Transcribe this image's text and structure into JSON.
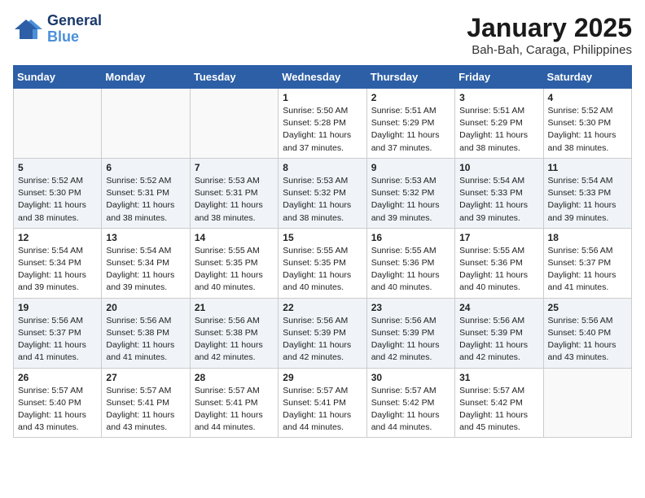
{
  "header": {
    "logo_line1": "General",
    "logo_line2": "Blue",
    "title": "January 2025",
    "subtitle": "Bah-Bah, Caraga, Philippines"
  },
  "days_of_week": [
    "Sunday",
    "Monday",
    "Tuesday",
    "Wednesday",
    "Thursday",
    "Friday",
    "Saturday"
  ],
  "weeks": [
    [
      {
        "day": "",
        "sunrise": "",
        "sunset": "",
        "daylight": ""
      },
      {
        "day": "",
        "sunrise": "",
        "sunset": "",
        "daylight": ""
      },
      {
        "day": "",
        "sunrise": "",
        "sunset": "",
        "daylight": ""
      },
      {
        "day": "1",
        "sunrise": "Sunrise: 5:50 AM",
        "sunset": "Sunset: 5:28 PM",
        "daylight": "Daylight: 11 hours and 37 minutes."
      },
      {
        "day": "2",
        "sunrise": "Sunrise: 5:51 AM",
        "sunset": "Sunset: 5:29 PM",
        "daylight": "Daylight: 11 hours and 37 minutes."
      },
      {
        "day": "3",
        "sunrise": "Sunrise: 5:51 AM",
        "sunset": "Sunset: 5:29 PM",
        "daylight": "Daylight: 11 hours and 38 minutes."
      },
      {
        "day": "4",
        "sunrise": "Sunrise: 5:52 AM",
        "sunset": "Sunset: 5:30 PM",
        "daylight": "Daylight: 11 hours and 38 minutes."
      }
    ],
    [
      {
        "day": "5",
        "sunrise": "Sunrise: 5:52 AM",
        "sunset": "Sunset: 5:30 PM",
        "daylight": "Daylight: 11 hours and 38 minutes."
      },
      {
        "day": "6",
        "sunrise": "Sunrise: 5:52 AM",
        "sunset": "Sunset: 5:31 PM",
        "daylight": "Daylight: 11 hours and 38 minutes."
      },
      {
        "day": "7",
        "sunrise": "Sunrise: 5:53 AM",
        "sunset": "Sunset: 5:31 PM",
        "daylight": "Daylight: 11 hours and 38 minutes."
      },
      {
        "day": "8",
        "sunrise": "Sunrise: 5:53 AM",
        "sunset": "Sunset: 5:32 PM",
        "daylight": "Daylight: 11 hours and 38 minutes."
      },
      {
        "day": "9",
        "sunrise": "Sunrise: 5:53 AM",
        "sunset": "Sunset: 5:32 PM",
        "daylight": "Daylight: 11 hours and 39 minutes."
      },
      {
        "day": "10",
        "sunrise": "Sunrise: 5:54 AM",
        "sunset": "Sunset: 5:33 PM",
        "daylight": "Daylight: 11 hours and 39 minutes."
      },
      {
        "day": "11",
        "sunrise": "Sunrise: 5:54 AM",
        "sunset": "Sunset: 5:33 PM",
        "daylight": "Daylight: 11 hours and 39 minutes."
      }
    ],
    [
      {
        "day": "12",
        "sunrise": "Sunrise: 5:54 AM",
        "sunset": "Sunset: 5:34 PM",
        "daylight": "Daylight: 11 hours and 39 minutes."
      },
      {
        "day": "13",
        "sunrise": "Sunrise: 5:54 AM",
        "sunset": "Sunset: 5:34 PM",
        "daylight": "Daylight: 11 hours and 39 minutes."
      },
      {
        "day": "14",
        "sunrise": "Sunrise: 5:55 AM",
        "sunset": "Sunset: 5:35 PM",
        "daylight": "Daylight: 11 hours and 40 minutes."
      },
      {
        "day": "15",
        "sunrise": "Sunrise: 5:55 AM",
        "sunset": "Sunset: 5:35 PM",
        "daylight": "Daylight: 11 hours and 40 minutes."
      },
      {
        "day": "16",
        "sunrise": "Sunrise: 5:55 AM",
        "sunset": "Sunset: 5:36 PM",
        "daylight": "Daylight: 11 hours and 40 minutes."
      },
      {
        "day": "17",
        "sunrise": "Sunrise: 5:55 AM",
        "sunset": "Sunset: 5:36 PM",
        "daylight": "Daylight: 11 hours and 40 minutes."
      },
      {
        "day": "18",
        "sunrise": "Sunrise: 5:56 AM",
        "sunset": "Sunset: 5:37 PM",
        "daylight": "Daylight: 11 hours and 41 minutes."
      }
    ],
    [
      {
        "day": "19",
        "sunrise": "Sunrise: 5:56 AM",
        "sunset": "Sunset: 5:37 PM",
        "daylight": "Daylight: 11 hours and 41 minutes."
      },
      {
        "day": "20",
        "sunrise": "Sunrise: 5:56 AM",
        "sunset": "Sunset: 5:38 PM",
        "daylight": "Daylight: 11 hours and 41 minutes."
      },
      {
        "day": "21",
        "sunrise": "Sunrise: 5:56 AM",
        "sunset": "Sunset: 5:38 PM",
        "daylight": "Daylight: 11 hours and 42 minutes."
      },
      {
        "day": "22",
        "sunrise": "Sunrise: 5:56 AM",
        "sunset": "Sunset: 5:39 PM",
        "daylight": "Daylight: 11 hours and 42 minutes."
      },
      {
        "day": "23",
        "sunrise": "Sunrise: 5:56 AM",
        "sunset": "Sunset: 5:39 PM",
        "daylight": "Daylight: 11 hours and 42 minutes."
      },
      {
        "day": "24",
        "sunrise": "Sunrise: 5:56 AM",
        "sunset": "Sunset: 5:39 PM",
        "daylight": "Daylight: 11 hours and 42 minutes."
      },
      {
        "day": "25",
        "sunrise": "Sunrise: 5:56 AM",
        "sunset": "Sunset: 5:40 PM",
        "daylight": "Daylight: 11 hours and 43 minutes."
      }
    ],
    [
      {
        "day": "26",
        "sunrise": "Sunrise: 5:57 AM",
        "sunset": "Sunset: 5:40 PM",
        "daylight": "Daylight: 11 hours and 43 minutes."
      },
      {
        "day": "27",
        "sunrise": "Sunrise: 5:57 AM",
        "sunset": "Sunset: 5:41 PM",
        "daylight": "Daylight: 11 hours and 43 minutes."
      },
      {
        "day": "28",
        "sunrise": "Sunrise: 5:57 AM",
        "sunset": "Sunset: 5:41 PM",
        "daylight": "Daylight: 11 hours and 44 minutes."
      },
      {
        "day": "29",
        "sunrise": "Sunrise: 5:57 AM",
        "sunset": "Sunset: 5:41 PM",
        "daylight": "Daylight: 11 hours and 44 minutes."
      },
      {
        "day": "30",
        "sunrise": "Sunrise: 5:57 AM",
        "sunset": "Sunset: 5:42 PM",
        "daylight": "Daylight: 11 hours and 44 minutes."
      },
      {
        "day": "31",
        "sunrise": "Sunrise: 5:57 AM",
        "sunset": "Sunset: 5:42 PM",
        "daylight": "Daylight: 11 hours and 45 minutes."
      },
      {
        "day": "",
        "sunrise": "",
        "sunset": "",
        "daylight": ""
      }
    ]
  ]
}
